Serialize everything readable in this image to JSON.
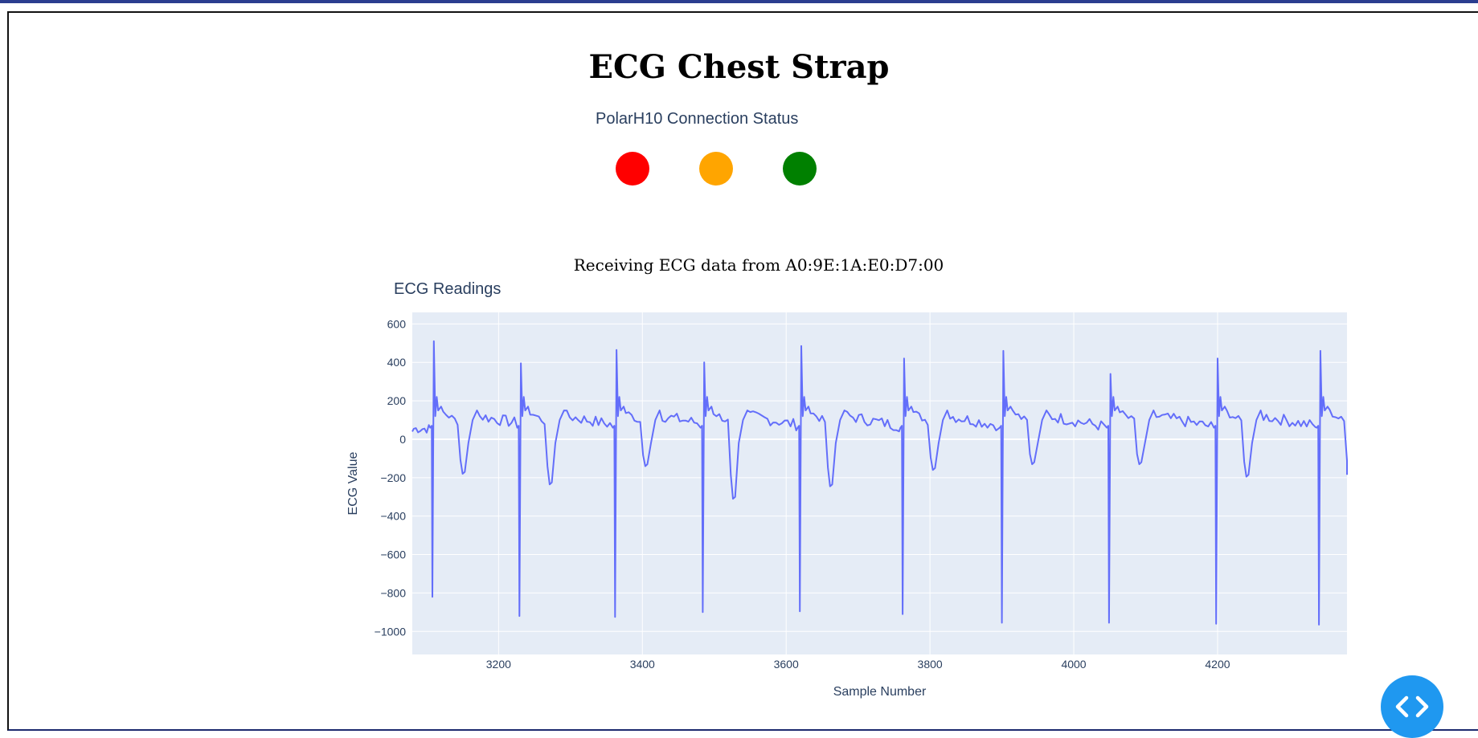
{
  "page": {
    "title": "ECG Chest Strap",
    "status_label": "PolarH10 Connection Status",
    "status_lights": [
      {
        "name": "disconnected",
        "color": "#ff0000"
      },
      {
        "name": "connecting",
        "color": "#ffa500"
      },
      {
        "name": "connected",
        "color": "#008000"
      }
    ],
    "receiving_text": "Receiving ECG data from A0:9E:1A:E0:D7:00",
    "code_toggle_icon": "code-brackets-icon"
  },
  "chart_data": {
    "type": "line",
    "title": "ECG Readings",
    "xlabel": "Sample Number",
    "ylabel": "ECG Value",
    "xlim": [
      3080,
      4380
    ],
    "ylim": [
      -1120,
      660
    ],
    "x_ticks": [
      3200,
      3400,
      3600,
      3800,
      4000,
      4200
    ],
    "y_ticks": [
      600,
      400,
      200,
      0,
      -200,
      -400,
      -600,
      -800,
      -1000
    ],
    "x_tick_labels": [
      "3200",
      "3400",
      "3600",
      "3800",
      "4000",
      "4200"
    ],
    "y_tick_labels": [
      "600",
      "400",
      "200",
      "0",
      "−200",
      "−400",
      "−600",
      "−800",
      "−1000"
    ],
    "grid": true,
    "line_color": "#636efa",
    "plot_bg": "#e5ecf6",
    "beats": [
      {
        "x": 3108,
        "r": 510,
        "s": -820,
        "t": -180
      },
      {
        "x": 3229,
        "r": 395,
        "s": -920,
        "t": -235
      },
      {
        "x": 3362,
        "r": 465,
        "s": -925,
        "t": -140
      },
      {
        "x": 3484,
        "r": 400,
        "s": -900,
        "t": -310
      },
      {
        "x": 3619,
        "r": 485,
        "s": -895,
        "t": -245
      },
      {
        "x": 3762,
        "r": 420,
        "s": -910,
        "t": -160
      },
      {
        "x": 3900,
        "r": 460,
        "s": -955,
        "t": -130
      },
      {
        "x": 4049,
        "r": 340,
        "s": -955,
        "t": -130
      },
      {
        "x": 4198,
        "r": 420,
        "s": -960,
        "t": -195
      },
      {
        "x": 4341,
        "r": 460,
        "s": -965,
        "t": -185
      }
    ],
    "end_value": -185
  }
}
